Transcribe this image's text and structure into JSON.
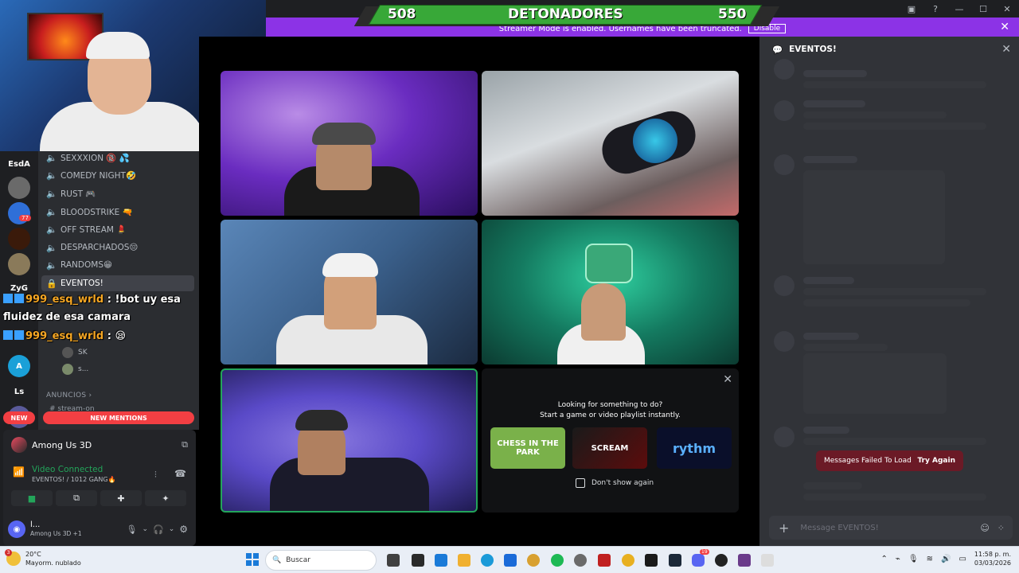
{
  "score": {
    "left": "508",
    "title": "DETONADORES",
    "right": "550"
  },
  "banner": {
    "text": "Streamer Mode is enabled. Usernames have been truncated.",
    "disable": "Disable"
  },
  "guilds": [
    "EsdA",
    "ZyG",
    "Ls"
  ],
  "guild_badge": "77",
  "channels": [
    {
      "label": "SEXXXION 🔞 💦"
    },
    {
      "label": "COMEDY NIGHT🤣"
    },
    {
      "label": "RUST 🎮"
    },
    {
      "label": "BLOODSTRIKE 🔫"
    },
    {
      "label": "OFF STREAM 💄"
    },
    {
      "label": "DESPARCHADOS😔"
    },
    {
      "label": "RANDOMS😁"
    },
    {
      "label": "EVENTOS!"
    }
  ],
  "chat": [
    {
      "user": "999_esq_wrld",
      "text": " : !bot uy esa"
    },
    {
      "user": "",
      "text": "fluidez de esa camara"
    },
    {
      "user": "999_esq_wrld",
      "text": " : 😪"
    }
  ],
  "voice_members": [
    "SK",
    "s..."
  ],
  "anuncios": "ANUNCIOS",
  "anuncios_channel": "stream-on",
  "new_pill": "NEW",
  "mentions_pill": "NEW MENTIONS",
  "activity": {
    "game": "Among Us 3D",
    "status": "Video Connected",
    "sub": "EVENTOS! / 1012 GANG🔥",
    "user": "l...",
    "user_sub": "Among Us 3D +1"
  },
  "suggest": {
    "line1": "Looking for something to do?",
    "line2": "Start a game or video playlist instantly.",
    "cards": [
      "CHESS IN THE PARK",
      "SCREAM",
      "rythm"
    ],
    "dont_show": "Don't show again"
  },
  "right": {
    "header": "EVENTOS!",
    "fail": "Messages Failed To Load",
    "try": "Try Again",
    "placeholder": "Message EVENTOS!"
  },
  "taskbar": {
    "weather_badge": "3",
    "temp": "20°C",
    "cond": "Mayorm. nublado",
    "search": "Buscar",
    "notif_badge": "19",
    "time": "11:58 p. m.",
    "date": "03/03/2026"
  },
  "colors": {
    "accent": "#8c33e6",
    "green": "#23a55a",
    "red": "#f23f43",
    "score_green": "#38a838"
  }
}
